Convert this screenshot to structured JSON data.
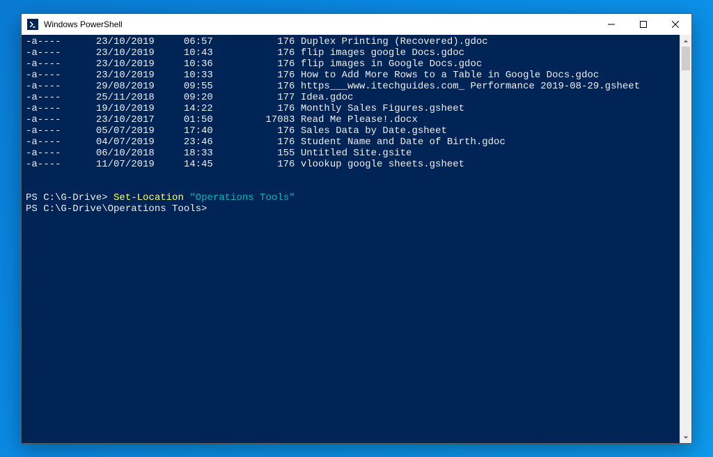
{
  "window": {
    "title": "Windows PowerShell"
  },
  "listing": [
    {
      "mode": "-a----",
      "date": "23/10/2019",
      "time": "06:57",
      "size": "176",
      "name": "Duplex Printing (Recovered).gdoc"
    },
    {
      "mode": "-a----",
      "date": "23/10/2019",
      "time": "10:43",
      "size": "176",
      "name": "flip images google Docs.gdoc"
    },
    {
      "mode": "-a----",
      "date": "23/10/2019",
      "time": "10:36",
      "size": "176",
      "name": "flip images in Google Docs.gdoc"
    },
    {
      "mode": "-a----",
      "date": "23/10/2019",
      "time": "10:33",
      "size": "176",
      "name": "How to Add More Rows to a Table in Google Docs.gdoc"
    },
    {
      "mode": "-a----",
      "date": "29/08/2019",
      "time": "09:55",
      "size": "176",
      "name": "https___www.itechguides.com_ Performance 2019-08-29.gsheet"
    },
    {
      "mode": "-a----",
      "date": "25/11/2018",
      "time": "09:20",
      "size": "177",
      "name": "Idea.gdoc"
    },
    {
      "mode": "-a----",
      "date": "19/10/2019",
      "time": "14:22",
      "size": "176",
      "name": "Monthly Sales Figures.gsheet"
    },
    {
      "mode": "-a----",
      "date": "23/10/2017",
      "time": "01:50",
      "size": "17083",
      "name": "Read Me Please!.docx"
    },
    {
      "mode": "-a----",
      "date": "05/07/2019",
      "time": "17:40",
      "size": "176",
      "name": "Sales Data by Date.gsheet"
    },
    {
      "mode": "-a----",
      "date": "04/07/2019",
      "time": "23:46",
      "size": "176",
      "name": "Student Name and Date of Birth.gdoc"
    },
    {
      "mode": "-a----",
      "date": "06/10/2018",
      "time": "18:33",
      "size": "155",
      "name": "Untitled Site.gsite"
    },
    {
      "mode": "-a----",
      "date": "11/07/2019",
      "time": "14:45",
      "size": "176",
      "name": "vlookup google sheets.gsheet"
    }
  ],
  "prompt1": {
    "prefix": "PS C:\\G-Drive> ",
    "cmdlet": "Set-Location",
    "arg": "\"Operations Tools\""
  },
  "prompt2": {
    "prefix": "PS C:\\G-Drive\\Operations Tools>"
  }
}
